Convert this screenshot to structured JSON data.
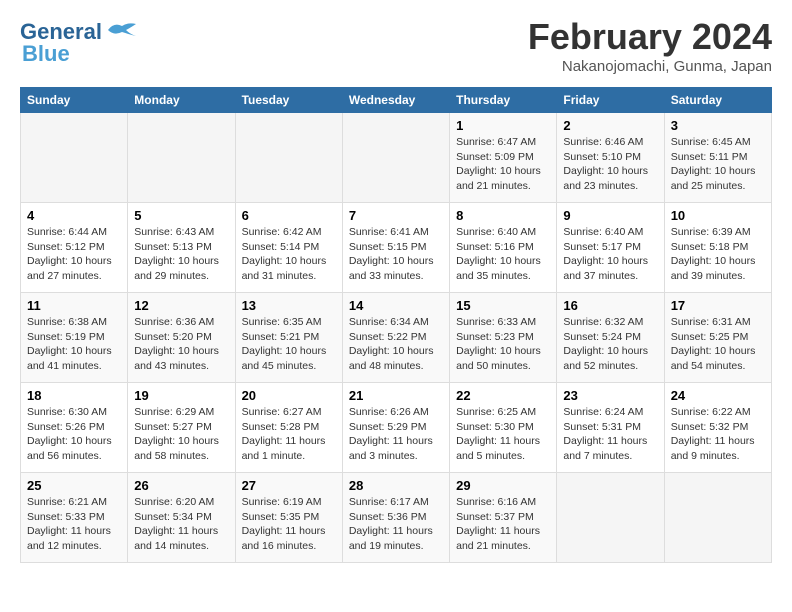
{
  "header": {
    "logo_line1": "General",
    "logo_line2": "Blue",
    "month": "February 2024",
    "location": "Nakanojomachi, Gunma, Japan"
  },
  "weekdays": [
    "Sunday",
    "Monday",
    "Tuesday",
    "Wednesday",
    "Thursday",
    "Friday",
    "Saturday"
  ],
  "weeks": [
    [
      {
        "day": "",
        "info": ""
      },
      {
        "day": "",
        "info": ""
      },
      {
        "day": "",
        "info": ""
      },
      {
        "day": "",
        "info": ""
      },
      {
        "day": "1",
        "info": "Sunrise: 6:47 AM\nSunset: 5:09 PM\nDaylight: 10 hours\nand 21 minutes."
      },
      {
        "day": "2",
        "info": "Sunrise: 6:46 AM\nSunset: 5:10 PM\nDaylight: 10 hours\nand 23 minutes."
      },
      {
        "day": "3",
        "info": "Sunrise: 6:45 AM\nSunset: 5:11 PM\nDaylight: 10 hours\nand 25 minutes."
      }
    ],
    [
      {
        "day": "4",
        "info": "Sunrise: 6:44 AM\nSunset: 5:12 PM\nDaylight: 10 hours\nand 27 minutes."
      },
      {
        "day": "5",
        "info": "Sunrise: 6:43 AM\nSunset: 5:13 PM\nDaylight: 10 hours\nand 29 minutes."
      },
      {
        "day": "6",
        "info": "Sunrise: 6:42 AM\nSunset: 5:14 PM\nDaylight: 10 hours\nand 31 minutes."
      },
      {
        "day": "7",
        "info": "Sunrise: 6:41 AM\nSunset: 5:15 PM\nDaylight: 10 hours\nand 33 minutes."
      },
      {
        "day": "8",
        "info": "Sunrise: 6:40 AM\nSunset: 5:16 PM\nDaylight: 10 hours\nand 35 minutes."
      },
      {
        "day": "9",
        "info": "Sunrise: 6:40 AM\nSunset: 5:17 PM\nDaylight: 10 hours\nand 37 minutes."
      },
      {
        "day": "10",
        "info": "Sunrise: 6:39 AM\nSunset: 5:18 PM\nDaylight: 10 hours\nand 39 minutes."
      }
    ],
    [
      {
        "day": "11",
        "info": "Sunrise: 6:38 AM\nSunset: 5:19 PM\nDaylight: 10 hours\nand 41 minutes."
      },
      {
        "day": "12",
        "info": "Sunrise: 6:36 AM\nSunset: 5:20 PM\nDaylight: 10 hours\nand 43 minutes."
      },
      {
        "day": "13",
        "info": "Sunrise: 6:35 AM\nSunset: 5:21 PM\nDaylight: 10 hours\nand 45 minutes."
      },
      {
        "day": "14",
        "info": "Sunrise: 6:34 AM\nSunset: 5:22 PM\nDaylight: 10 hours\nand 48 minutes."
      },
      {
        "day": "15",
        "info": "Sunrise: 6:33 AM\nSunset: 5:23 PM\nDaylight: 10 hours\nand 50 minutes."
      },
      {
        "day": "16",
        "info": "Sunrise: 6:32 AM\nSunset: 5:24 PM\nDaylight: 10 hours\nand 52 minutes."
      },
      {
        "day": "17",
        "info": "Sunrise: 6:31 AM\nSunset: 5:25 PM\nDaylight: 10 hours\nand 54 minutes."
      }
    ],
    [
      {
        "day": "18",
        "info": "Sunrise: 6:30 AM\nSunset: 5:26 PM\nDaylight: 10 hours\nand 56 minutes."
      },
      {
        "day": "19",
        "info": "Sunrise: 6:29 AM\nSunset: 5:27 PM\nDaylight: 10 hours\nand 58 minutes."
      },
      {
        "day": "20",
        "info": "Sunrise: 6:27 AM\nSunset: 5:28 PM\nDaylight: 11 hours\nand 1 minute."
      },
      {
        "day": "21",
        "info": "Sunrise: 6:26 AM\nSunset: 5:29 PM\nDaylight: 11 hours\nand 3 minutes."
      },
      {
        "day": "22",
        "info": "Sunrise: 6:25 AM\nSunset: 5:30 PM\nDaylight: 11 hours\nand 5 minutes."
      },
      {
        "day": "23",
        "info": "Sunrise: 6:24 AM\nSunset: 5:31 PM\nDaylight: 11 hours\nand 7 minutes."
      },
      {
        "day": "24",
        "info": "Sunrise: 6:22 AM\nSunset: 5:32 PM\nDaylight: 11 hours\nand 9 minutes."
      }
    ],
    [
      {
        "day": "25",
        "info": "Sunrise: 6:21 AM\nSunset: 5:33 PM\nDaylight: 11 hours\nand 12 minutes."
      },
      {
        "day": "26",
        "info": "Sunrise: 6:20 AM\nSunset: 5:34 PM\nDaylight: 11 hours\nand 14 minutes."
      },
      {
        "day": "27",
        "info": "Sunrise: 6:19 AM\nSunset: 5:35 PM\nDaylight: 11 hours\nand 16 minutes."
      },
      {
        "day": "28",
        "info": "Sunrise: 6:17 AM\nSunset: 5:36 PM\nDaylight: 11 hours\nand 19 minutes."
      },
      {
        "day": "29",
        "info": "Sunrise: 6:16 AM\nSunset: 5:37 PM\nDaylight: 11 hours\nand 21 minutes."
      },
      {
        "day": "",
        "info": ""
      },
      {
        "day": "",
        "info": ""
      }
    ]
  ]
}
